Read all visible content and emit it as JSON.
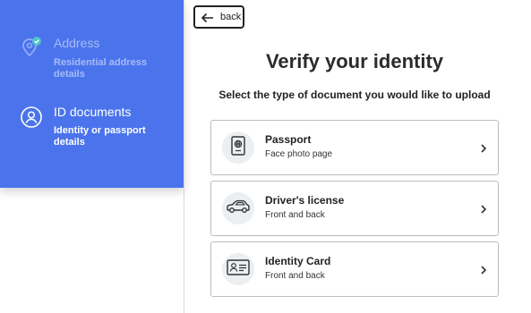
{
  "sidebar": {
    "steps": [
      {
        "title": "Address",
        "subtitle": "Residential address details",
        "icon": "location-check-icon",
        "state": "completed"
      },
      {
        "title": "ID documents",
        "subtitle": "Identity or passport details",
        "icon": "person-icon",
        "state": "active"
      }
    ],
    "accent_color": "#4b74ec"
  },
  "header": {
    "back_label": "back",
    "title": "Verify your identity",
    "subtitle": "Select the type of document you would like to upload"
  },
  "documents": [
    {
      "title": "Passport",
      "subtitle": "Face photo page",
      "icon": "passport-icon"
    },
    {
      "title": "Driver's license",
      "subtitle": "Front and back",
      "icon": "car-icon"
    },
    {
      "title": "Identity Card",
      "subtitle": "Front and back",
      "icon": "id-card-icon"
    }
  ]
}
